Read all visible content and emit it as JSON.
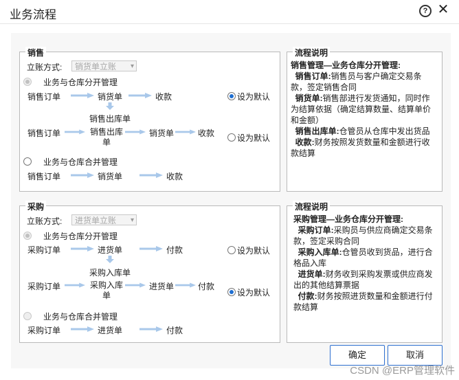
{
  "window": {
    "title": "业务流程",
    "help_icon": "?",
    "close_icon": "✕"
  },
  "sales": {
    "legend": "销售",
    "method_label": "立账方式:",
    "method_value": "销货单立账",
    "sep_option": "业务与仓库分开管理",
    "merge_option": "业务与仓库合并管理",
    "flow1": [
      "销售订单",
      "销货单",
      "收款"
    ],
    "mid_node": "销售出库单",
    "flow2": [
      "销售订单",
      "销售出库单",
      "销货单",
      "收款"
    ],
    "flow3": [
      "销售订单",
      "销货单",
      "收款"
    ],
    "default_label": "设为默认"
  },
  "sales_desc": {
    "legend": "流程说明",
    "heading": "销售管理—业务仓库分开管理:",
    "items": [
      {
        "term": "销售订单:",
        "text": "销售员与客户确定交易条款，签定销售合同"
      },
      {
        "term": "销货单:",
        "text": "销售部进行发货通知，同时作为结算依据（确定结算数量、结算单价和金额）"
      },
      {
        "term": "销售出库单:",
        "text": "仓管员从仓库中发出货品"
      },
      {
        "term": "收款:",
        "text": "财务按照发货数量和金额进行收款结算"
      }
    ]
  },
  "purchase": {
    "legend": "采购",
    "method_label": "立账方式:",
    "method_value": "进货单立账",
    "sep_option": "业务与仓库分开管理",
    "merge_option": "业务与仓库合并管理",
    "flow1": [
      "采购订单",
      "进货单",
      "付款"
    ],
    "mid_node": "采购入库单",
    "flow2": [
      "采购订单",
      "采购入库单",
      "进货单",
      "付款"
    ],
    "flow3": [
      "采购订单",
      "进货单",
      "付款"
    ],
    "default_label": "设为默认"
  },
  "purchase_desc": {
    "legend": "流程说明",
    "heading": "采购管理—业务仓库分开管理:",
    "items": [
      {
        "term": "采购订单:",
        "text": "采购员与供应商确定交易条款，签定采购合同"
      },
      {
        "term": "采购入库单:",
        "text": "仓管员收到货品，进行合格品入库"
      },
      {
        "term": "进货单:",
        "text": "财务收到采购发票或供应商发出的其他结算票据"
      },
      {
        "term": "付款:",
        "text": "财务按照进货数量和金额进行付款结算"
      }
    ]
  },
  "buttons": {
    "ok": "确定",
    "cancel": "取消"
  },
  "watermark": "CSDN @ERP管理软件",
  "colors": {
    "accent": "#1f6fd1",
    "arrow": "#a9c8ea"
  }
}
